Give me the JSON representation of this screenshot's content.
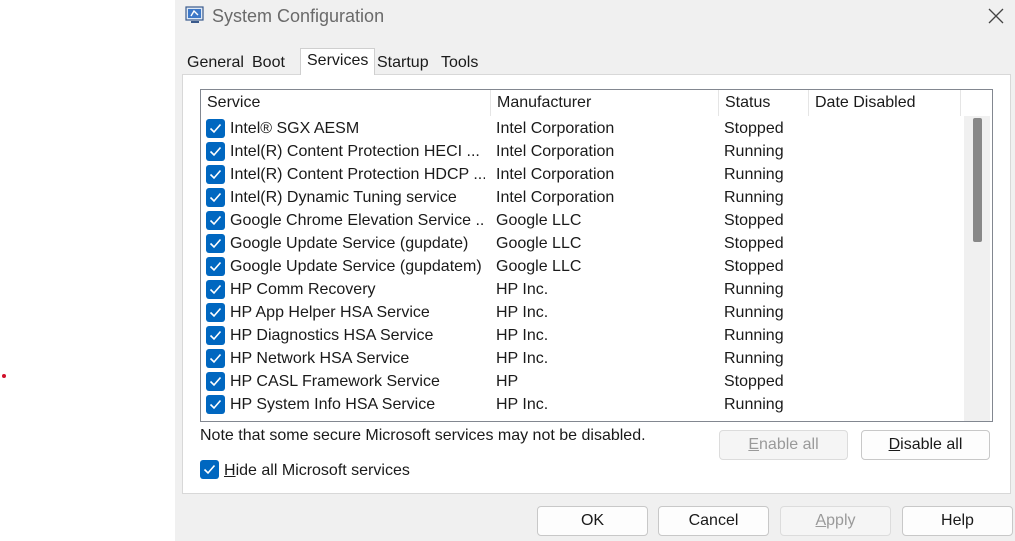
{
  "window": {
    "title": "System Configuration"
  },
  "tabs": [
    {
      "label": "General"
    },
    {
      "label": "Boot"
    },
    {
      "label": "Services"
    },
    {
      "label": "Startup"
    },
    {
      "label": "Tools"
    }
  ],
  "columns": {
    "service": "Service",
    "manufacturer": "Manufacturer",
    "status": "Status",
    "date_disabled": "Date Disabled"
  },
  "services": [
    {
      "service": "Intel® SGX AESM",
      "manufacturer": "Intel Corporation",
      "status": "Stopped",
      "checked": true
    },
    {
      "service": "Intel(R) Content Protection HECI ...",
      "manufacturer": "Intel Corporation",
      "status": "Running",
      "checked": true
    },
    {
      "service": "Intel(R) Content Protection HDCP ...",
      "manufacturer": "Intel Corporation",
      "status": "Running",
      "checked": true
    },
    {
      "service": "Intel(R) Dynamic Tuning service",
      "manufacturer": "Intel Corporation",
      "status": "Running",
      "checked": true
    },
    {
      "service": "Google Chrome Elevation Service ...",
      "manufacturer": "Google LLC",
      "status": "Stopped",
      "checked": true
    },
    {
      "service": "Google Update Service (gupdate)",
      "manufacturer": "Google LLC",
      "status": "Stopped",
      "checked": true
    },
    {
      "service": "Google Update Service (gupdatem)",
      "manufacturer": "Google LLC",
      "status": "Stopped",
      "checked": true
    },
    {
      "service": "HP Comm Recovery",
      "manufacturer": "HP Inc.",
      "status": "Running",
      "checked": true
    },
    {
      "service": "HP App Helper HSA Service",
      "manufacturer": "HP Inc.",
      "status": "Running",
      "checked": true
    },
    {
      "service": "HP Diagnostics HSA Service",
      "manufacturer": "HP Inc.",
      "status": "Running",
      "checked": true
    },
    {
      "service": "HP Network HSA Service",
      "manufacturer": "HP Inc.",
      "status": "Running",
      "checked": true
    },
    {
      "service": "HP CASL Framework Service",
      "manufacturer": "HP",
      "status": "Stopped",
      "checked": true
    },
    {
      "service": "HP System Info HSA Service",
      "manufacturer": "HP Inc.",
      "status": "Running",
      "checked": true
    }
  ],
  "note": "Note that some secure Microsoft services may not be disabled.",
  "buttons": {
    "enable_all_mn": "E",
    "enable_all_rest": "nable all",
    "disable_all_mn": "D",
    "disable_all_rest": "isable all",
    "ok": "OK",
    "cancel": "Cancel",
    "apply_mn": "A",
    "apply_rest": "pply",
    "help": "Help"
  },
  "hide_ms": {
    "mn": "H",
    "rest": "ide all Microsoft services",
    "checked": true
  },
  "colors": {
    "accent": "#0067c0",
    "window_bg": "#f0f0f0",
    "disabled_text": "#9a9a9a"
  }
}
